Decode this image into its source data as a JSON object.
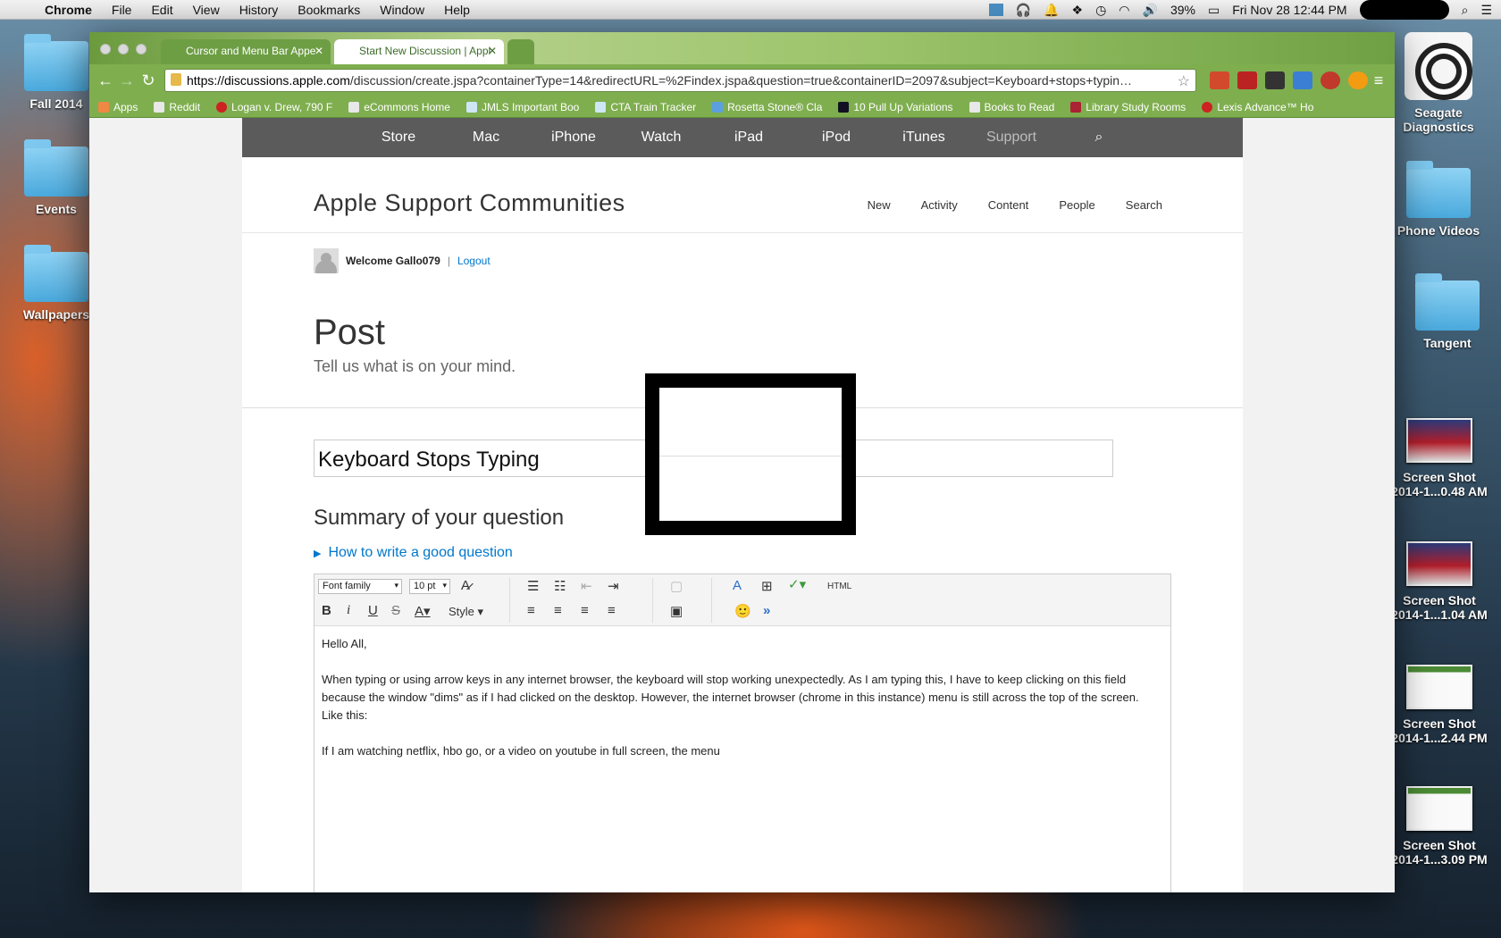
{
  "menubar": {
    "app": "Chrome",
    "items": [
      "File",
      "Edit",
      "View",
      "History",
      "Bookmarks",
      "Window",
      "Help"
    ],
    "battery": "39%",
    "datetime": "Fri Nov 28  12:44 PM"
  },
  "desktop": {
    "left": [
      "Fall 2014",
      "Events",
      "Wallpapers"
    ],
    "right": [
      {
        "label": "Seagate Diagnostics"
      },
      {
        "label": "Phone Videos"
      },
      {
        "label": "Tangent"
      },
      {
        "label": "Screen Shot 2014-1...0.48 AM"
      },
      {
        "label": "Screen Shot 2014-1...1.04 AM"
      },
      {
        "label": "Screen Shot 2014-1...2.44 PM"
      },
      {
        "label": "Screen Shot 2014-1...3.09 PM"
      }
    ]
  },
  "browser": {
    "tabs": [
      {
        "title": "Cursor and Menu Bar Appe"
      },
      {
        "title": "Start New Discussion | Appl"
      }
    ],
    "url_host": "https://discussions.apple.com",
    "url_path": "/discussion/create.jspa?containerType=14&redirectURL=%2Findex.jspa&question=true&containerID=2097&subject=Keyboard+stops+typin…",
    "bookmarks": [
      "Apps",
      "Reddit",
      "Logan v. Drew, 790 F",
      "eCommons Home",
      "JMLS Important Boo",
      "CTA Train Tracker",
      "Rosetta Stone® Cla",
      "10 Pull Up Variations",
      "Books to Read",
      "Library Study Rooms",
      "Lexis Advance™ Ho"
    ]
  },
  "apple_nav": [
    "Store",
    "Mac",
    "iPhone",
    "Watch",
    "iPad",
    "iPod",
    "iTunes",
    "Support"
  ],
  "community": {
    "title": "Apple Support Communities",
    "subnav": [
      "New",
      "Activity",
      "Content",
      "People",
      "Search"
    ],
    "welcome": "Welcome Gallo079",
    "sep": "|",
    "logout": "Logout"
  },
  "post": {
    "heading": "Post",
    "subheading": "Tell us what is on your mind.",
    "subject_value": "Keyboard Stops Typing",
    "summary_heading": "Summary of your question",
    "howto": "How to write a good question"
  },
  "editor": {
    "font_family": "Font family",
    "font_size": "10 pt",
    "style": "Style",
    "html": "HTML",
    "body": [
      "Hello All,",
      "",
      "When typing or using arrow keys in any internet browser, the keyboard will stop working unexpectedly. As I am typing this, I have to keep clicking on this field because the window \"dims\" as if I had clicked on the desktop. However, the internet browser (chrome in this instance) menu is still across the top of the screen. Like this:",
      "",
      "If I am watching netflix, hbo go, or a video on youtube in full screen, the menu"
    ]
  }
}
